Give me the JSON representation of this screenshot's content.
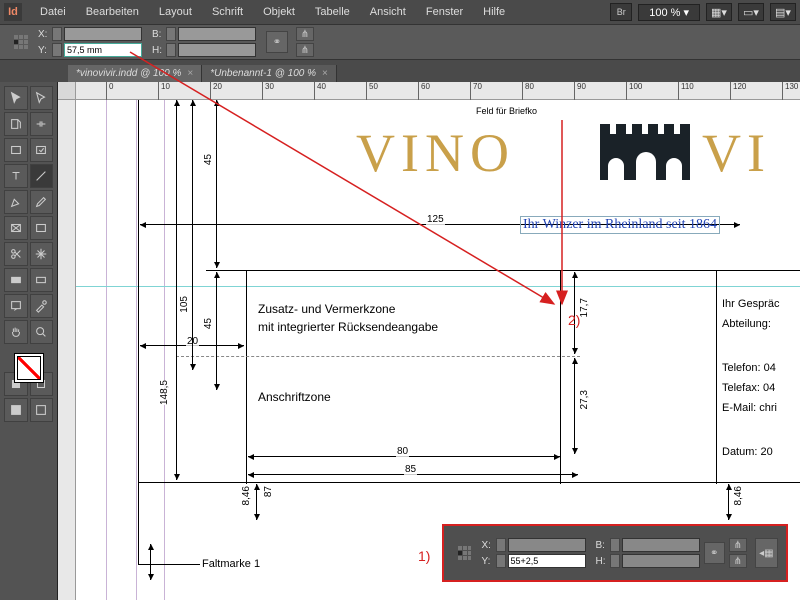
{
  "menu": {
    "app": "Id",
    "items": [
      "Datei",
      "Bearbeiten",
      "Layout",
      "Schrift",
      "Objekt",
      "Tabelle",
      "Ansicht",
      "Fenster",
      "Hilfe"
    ],
    "br": "Br",
    "zoom": "100 %"
  },
  "control": {
    "x_label": "X:",
    "y_label": "Y:",
    "w_label": "B:",
    "h_label": "H:",
    "x_value": "",
    "y_value": "57,5 mm",
    "w_value": "",
    "h_value": ""
  },
  "tabs": [
    {
      "label": "*vinovivir.indd @ 100 %",
      "active": true
    },
    {
      "label": "*Unbenannt-1 @ 100 %",
      "active": false
    }
  ],
  "ruler_ticks": [
    0,
    10,
    20,
    30,
    40,
    50,
    60,
    70,
    80,
    90,
    100,
    110,
    120,
    130
  ],
  "doc": {
    "logo_a": "VINO",
    "logo_b": "VI",
    "tagline": "Ihr Winzer im Rheinland seit 1864",
    "zone1_l1": "Zusatz- und Vermerkzone",
    "zone1_l2": "mit integrierter Rücksendeangabe",
    "zone2": "Anschriftzone",
    "fold": "Faltmarke 1",
    "right_lines": [
      "Ihr Gespräc",
      "Abteilung:",
      "Telefon: 04",
      "Telefax: 04",
      "E-Mail: chri",
      "Datum: 20"
    ],
    "top_label": "Feld für Briefko"
  },
  "dims": {
    "d125": "125",
    "d45a": "45",
    "d45b": "45",
    "d20": "20",
    "d105": "105",
    "d1485": "148,5",
    "d177": "17,7",
    "d273": "27,3",
    "d80": "80",
    "d85": "85",
    "d846a": "8,46",
    "d846b": "8,46",
    "d87": "87"
  },
  "annotations": {
    "one": "1)",
    "two": "2)"
  },
  "inset": {
    "x_label": "X:",
    "y_label": "Y:",
    "w_label": "B:",
    "h_label": "H:",
    "x_value": "",
    "y_value": "55+2,5",
    "w_value": "",
    "h_value": ""
  }
}
